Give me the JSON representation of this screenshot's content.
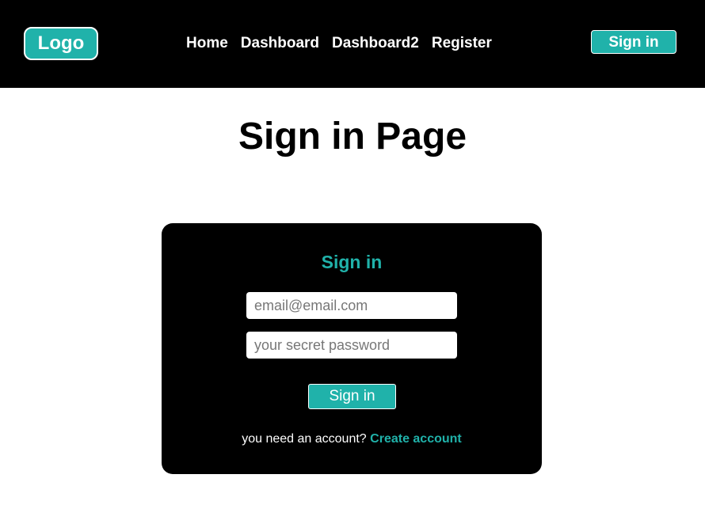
{
  "colors": {
    "accent": "#20b2aa",
    "nav_background": "#000000",
    "card_background": "#000000",
    "page_background": "#ffffff",
    "text_light": "#ffffff"
  },
  "navbar": {
    "logo_label": "Logo",
    "links": [
      {
        "label": "Home"
      },
      {
        "label": "Dashboard"
      },
      {
        "label": "Dashboard2"
      },
      {
        "label": "Register"
      }
    ],
    "signin_label": "Sign in"
  },
  "page": {
    "title": "Sign in Page"
  },
  "signin_card": {
    "title": "Sign in",
    "email": {
      "placeholder": "email@email.com",
      "value": ""
    },
    "password": {
      "placeholder": "your secret password",
      "value": ""
    },
    "submit_label": "Sign in",
    "account_prompt": "you need an account?",
    "create_account_label": "Create account"
  }
}
